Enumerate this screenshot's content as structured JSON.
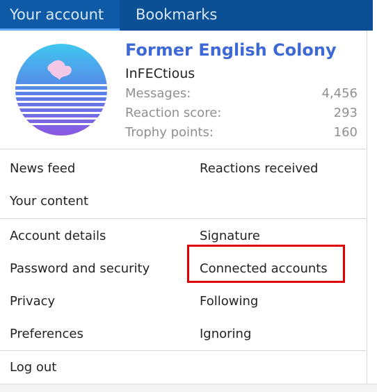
{
  "tabs": [
    {
      "label": "Your account"
    },
    {
      "label": "Bookmarks"
    }
  ],
  "profile": {
    "title": "Former English Colony",
    "username": "InFECtious",
    "stats": [
      {
        "label": "Messages:",
        "value": "4,456"
      },
      {
        "label": "Reaction score:",
        "value": "293"
      },
      {
        "label": "Trophy points:",
        "value": "160"
      }
    ]
  },
  "menu": {
    "news_feed": "News feed",
    "reactions_received": "Reactions received",
    "your_content": "Your content",
    "account_details": "Account details",
    "signature": "Signature",
    "password_security": "Password and security",
    "connected_accounts": "Connected accounts",
    "privacy": "Privacy",
    "following": "Following",
    "preferences": "Preferences",
    "ignoring": "Ignoring",
    "log_out": "Log out"
  },
  "colors": {
    "tab_bar": "#0b4f94",
    "title": "#3d68d6",
    "highlight": "#e00000"
  }
}
